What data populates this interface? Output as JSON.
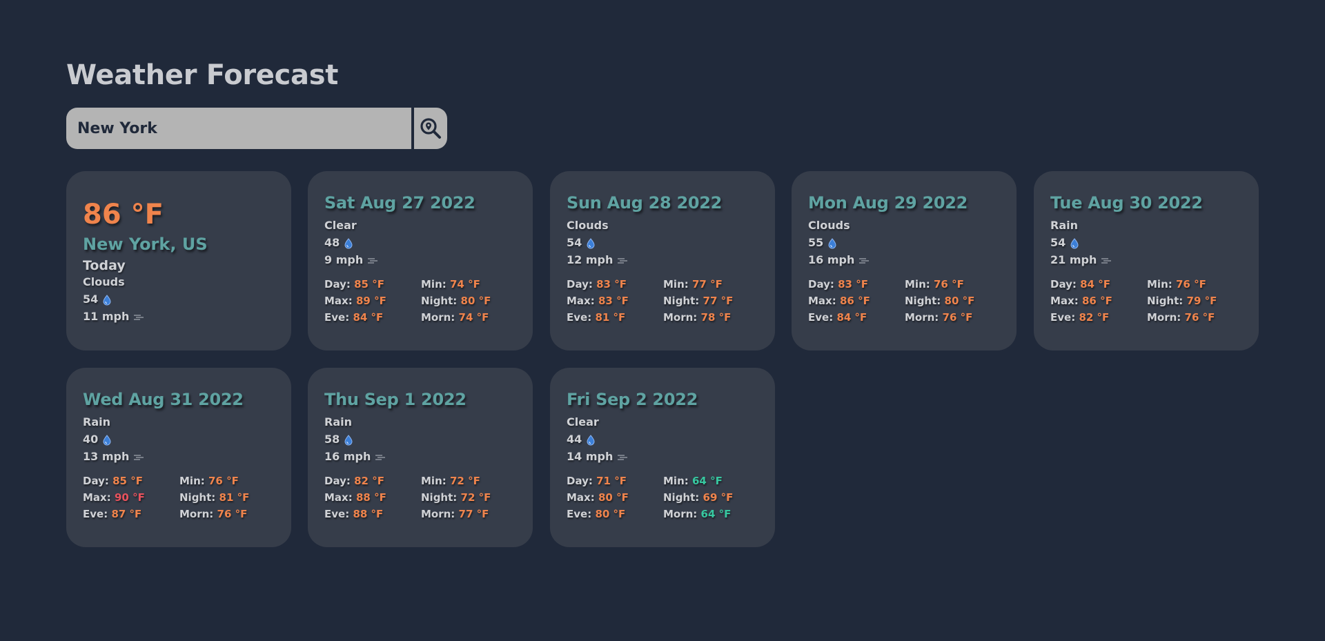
{
  "header": {
    "title": "Weather Forecast"
  },
  "search": {
    "value": "New York"
  },
  "colors": {
    "background": "#20293a",
    "card": "#363d4a",
    "accent_teal": "#5fa3a2",
    "warm": "#f0844c",
    "hot": "#e8525d",
    "cool": "#37c8a0"
  },
  "today": {
    "temp": "86 °F",
    "location": "New York, US",
    "label": "Today",
    "condition": "Clouds",
    "humidity": "54",
    "wind": "11 mph"
  },
  "forecast": [
    {
      "date": "Sat Aug 27 2022",
      "condition": "Clear",
      "humidity": "48",
      "wind": "9 mph",
      "day": "85 °F",
      "min": "74 °F",
      "max": "89 °F",
      "night": "80 °F",
      "eve": "84 °F",
      "morn": "74 °F"
    },
    {
      "date": "Sun Aug 28 2022",
      "condition": "Clouds",
      "humidity": "54",
      "wind": "12 mph",
      "day": "83 °F",
      "min": "77 °F",
      "max": "83 °F",
      "night": "77 °F",
      "eve": "81 °F",
      "morn": "78 °F"
    },
    {
      "date": "Mon Aug 29 2022",
      "condition": "Clouds",
      "humidity": "55",
      "wind": "16 mph",
      "day": "83 °F",
      "min": "76 °F",
      "max": "86 °F",
      "night": "80 °F",
      "eve": "84 °F",
      "morn": "76 °F"
    },
    {
      "date": "Tue Aug 30 2022",
      "condition": "Rain",
      "humidity": "54",
      "wind": "21 mph",
      "day": "84 °F",
      "min": "76 °F",
      "max": "86 °F",
      "night": "79 °F",
      "eve": "82 °F",
      "morn": "76 °F"
    },
    {
      "date": "Wed Aug 31 2022",
      "condition": "Rain",
      "humidity": "40",
      "wind": "13 mph",
      "day": "85 °F",
      "min": "76 °F",
      "max": "90 °F",
      "night": "81 °F",
      "eve": "87 °F",
      "morn": "76 °F"
    },
    {
      "date": "Thu Sep 1 2022",
      "condition": "Rain",
      "humidity": "58",
      "wind": "16 mph",
      "day": "82 °F",
      "min": "72 °F",
      "max": "88 °F",
      "night": "72 °F",
      "eve": "88 °F",
      "morn": "77 °F"
    },
    {
      "date": "Fri Sep 2 2022",
      "condition": "Clear",
      "humidity": "44",
      "wind": "14 mph",
      "day": "71 °F",
      "min": "64 °F",
      "max": "80 °F",
      "night": "69 °F",
      "eve": "80 °F",
      "morn": "64 °F"
    }
  ],
  "labels": {
    "day": "Day:",
    "min": "Min:",
    "max": "Max:",
    "night": "Night:",
    "eve": "Eve:",
    "morn": "Morn:"
  },
  "icons": {
    "search": "search-location-icon",
    "humidity": "droplet-icon",
    "wind": "wind-icon"
  }
}
